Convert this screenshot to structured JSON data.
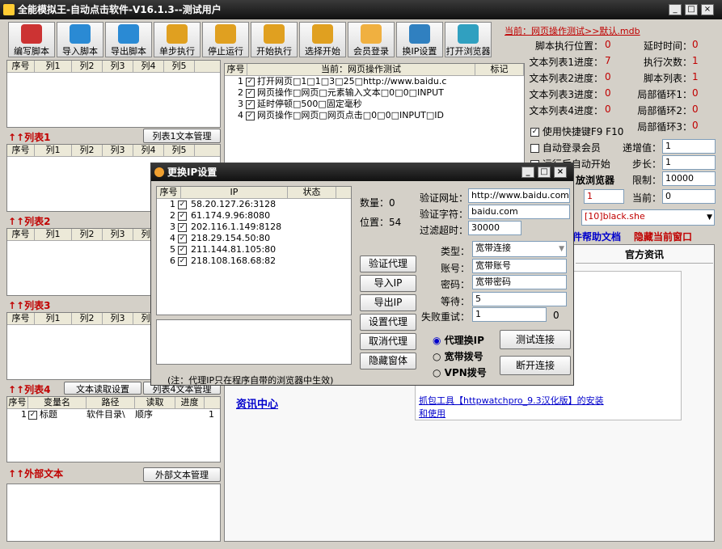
{
  "app": {
    "title": "全能模拟王-自动点击软件-V16.1.3--测试用户",
    "win_min": "_",
    "win_max": "□",
    "win_close": "×"
  },
  "toolbar": [
    "编写脚本",
    "导入脚本",
    "导出脚本",
    "单步执行",
    "停止运行",
    "开始执行",
    "选择开始",
    "会员登录",
    "换IP设置",
    "打开浏览器"
  ],
  "current": "当前：网页操作测试>>默认.mdb",
  "lists": {
    "cols": [
      "序号",
      "列1",
      "列2",
      "列3",
      "列4",
      "列5"
    ],
    "list1": "列表1",
    "list1_btn": "列表1文本管理",
    "list2": "列表2",
    "list3": "列表3",
    "list4": "列表4",
    "list4_btn": "文本读取设置",
    "list4_btn2": "列表4文本管理",
    "list4_cols": [
      "序号",
      "变量名",
      "路径",
      "读取",
      "进度"
    ],
    "list4_row": {
      "n": "1",
      "name": "标题",
      "path": "软件目录\\",
      "read": "顺序",
      "prog": "1"
    },
    "ext": "外部文本",
    "ext_btn": "外部文本管理"
  },
  "script": {
    "cols": [
      "序号",
      "当前：网页操作测试",
      "标记"
    ],
    "rows": [
      {
        "n": "1",
        "t": "打开网页□1□1□3□25□http://www.baidu.c"
      },
      {
        "n": "2",
        "t": "网页操作□网页□元素输入文本□0□0□INPUT"
      },
      {
        "n": "3",
        "t": "延时停顿□500□固定毫秒"
      },
      {
        "n": "4",
        "t": "网页操作□网页□网页点击□0□0□INPUT□ID"
      }
    ]
  },
  "stats": {
    "l1": "脚本执行位置：",
    "v1": "0",
    "l2": "延时时间：",
    "v2": "0",
    "l3": "文本列表1进度：",
    "v3": "7",
    "l4": "执行次数：",
    "v4": "1",
    "l5": "文本列表2进度：",
    "v5": "0",
    "l6": "脚本列表：",
    "v6": "1",
    "l7": "文本列表3进度：",
    "v7": "0",
    "l8": "局部循环1：",
    "v8": "0",
    "l9": "文本列表4进度：",
    "v9": "0",
    "l10": "局部循环2：",
    "v10": "0",
    "l11": "局部循环3：",
    "v11": "0"
  },
  "options": {
    "hotkey": "使用快捷键F9 F10",
    "autologin": "自动登录会员",
    "autostart": "运行后自动开始",
    "browser": "放浏览器",
    "inc_label": "递增值：",
    "inc": "1",
    "step_label": "步长：",
    "step": "1",
    "limit_label": "限制：",
    "limit": "10000",
    "cur_label": "当前：",
    "cur": "0",
    "num": "1",
    "black": "[10]black.she",
    "help": "件帮助文档",
    "hide": "隐藏当前窗口"
  },
  "news": {
    "tab": "官方资讯",
    "center": "资讯中心",
    "item": "抓包工具【httpwatchpro_9.3汉化版】的安装和使用"
  },
  "dialog": {
    "title": "更换IP设置",
    "cols": [
      "序号",
      "IP",
      "状态"
    ],
    "ips": [
      {
        "n": "1",
        "ip": "58.20.127.26:3128"
      },
      {
        "n": "2",
        "ip": "61.174.9.96:8080"
      },
      {
        "n": "3",
        "ip": "202.116.1.149:8128"
      },
      {
        "n": "4",
        "ip": "218.29.154.50:80"
      },
      {
        "n": "5",
        "ip": "211.144.81.105:80"
      },
      {
        "n": "6",
        "ip": "218.108.168.68:82"
      }
    ],
    "count_label": "数量：",
    "count": "0",
    "pos_label": "位置：",
    "pos": "54",
    "url_label": "验证网址：",
    "url": "http://www.baidu.com",
    "char_label": "验证字符：",
    "char": "baidu.com",
    "timeout_label": "过滤超时：",
    "timeout": "30000",
    "type_label": "类型：",
    "type": "宽带连接",
    "acct_label": "账号：",
    "acct": "宽带账号",
    "pwd_label": "密码：",
    "pwd": "宽带密码",
    "wait_label": "等待：",
    "wait": "5",
    "retry_label": "失败重试：",
    "retry": "1",
    "retry_n": "0",
    "btns": [
      "验证代理",
      "导入IP",
      "导出IP",
      "设置代理",
      "取消代理",
      "隐藏窗体"
    ],
    "radios": [
      "代理换IP",
      "宽带拨号",
      "VPN拨号"
    ],
    "test": "测试连接",
    "disc": "断开连接",
    "note": "(注：代理IP只在程序自带的浏览器中生效)"
  }
}
